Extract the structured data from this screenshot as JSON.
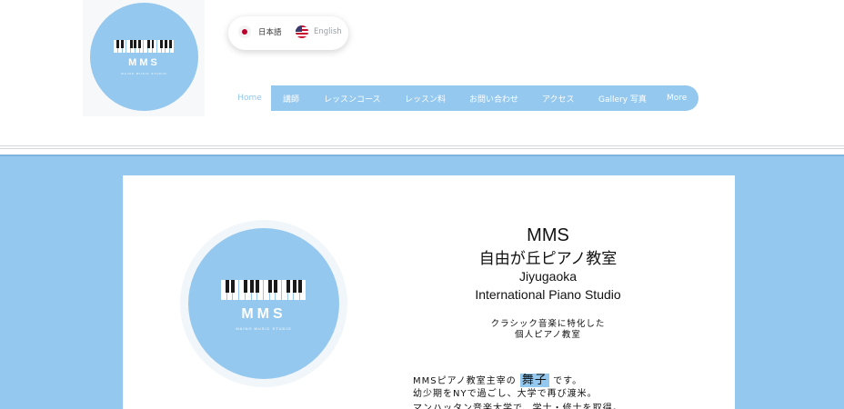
{
  "logo": {
    "mark": "MMS",
    "subtitle": "MAINO MUSIC STUDIO"
  },
  "languages": [
    {
      "label": "日本語",
      "icon": "japan-flag-icon",
      "active": true
    },
    {
      "label": "English",
      "icon": "us-flag-icon",
      "active": false
    }
  ],
  "nav": {
    "home": "Home",
    "items": [
      "講師",
      "レッスンコース",
      "レッスン料",
      "お問い合わせ",
      "アクセス",
      "Gallery 写真",
      "More"
    ]
  },
  "hero": {
    "title_mms": "MMS",
    "title_jp": "自由が丘ピアノ教室",
    "title_en_1": "Jiyugaoka",
    "title_en_2": "International Piano Studio",
    "tagline_1": "クラシック音楽に特化した",
    "tagline_2": "個人ピアノ教室",
    "intro_1_before": "MMSピアノ教室主宰の",
    "intro_1_name": "舞子",
    "intro_1_after": "です。",
    "intro_2": "幼少期をNYで過ごし、大学で再び渡米。",
    "intro_3": "マンハッタン音楽大学で、学士・修士を取得。"
  },
  "colors": {
    "brand_blue": "#94c8ee",
    "text": "#111111",
    "home_link": "#94c8ee"
  }
}
